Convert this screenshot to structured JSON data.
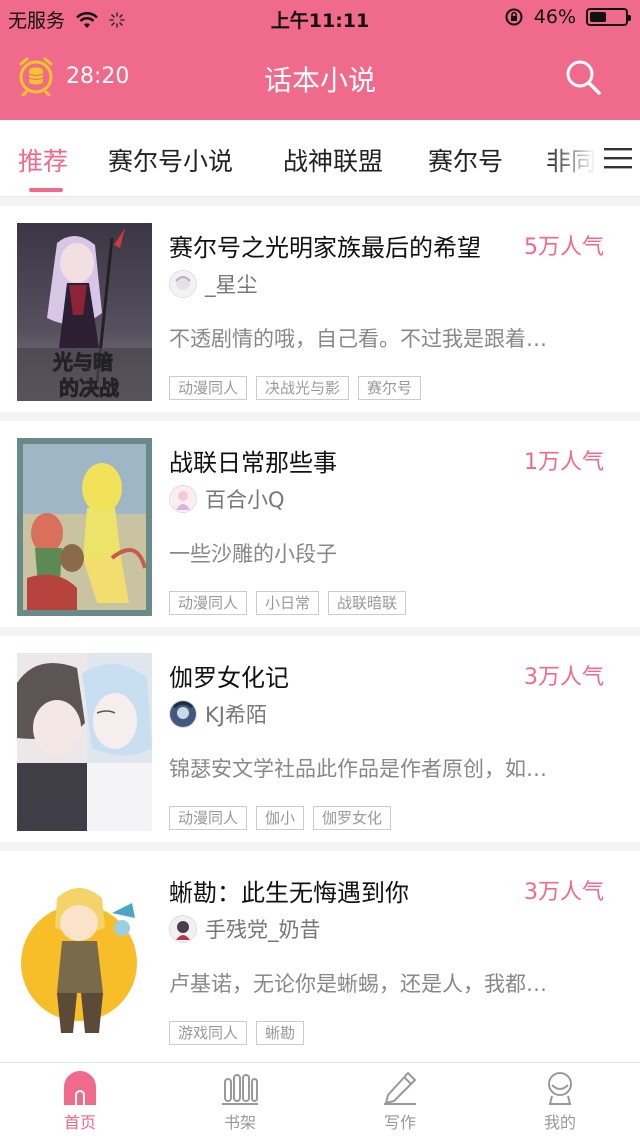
{
  "status_bar": {
    "carrier": "无服务",
    "time": "上午11:11",
    "battery_text": "46%",
    "battery_level": 0.46
  },
  "header": {
    "timer_text": "28:20",
    "title": "话本小说",
    "timer_icon": "alarm-clock-coin-icon",
    "search_icon": "search-icon"
  },
  "tabs": [
    {
      "label": "推荐",
      "active": true
    },
    {
      "label": "赛尔号小说"
    },
    {
      "label": "战神联盟"
    },
    {
      "label": "赛尔号"
    },
    {
      "label": "非同"
    }
  ],
  "menu_icon": "menu-icon",
  "books": [
    {
      "title": "赛尔号之光明家族最后的希望",
      "popularity": "5万人气",
      "author": "_星尘",
      "description": "不透剧情的哦，自己看。不过我是跟着…",
      "tags": [
        "动漫同人",
        "决战光与影",
        "赛尔号"
      ],
      "cover_text": "光与暗的决战"
    },
    {
      "title": "战联日常那些事",
      "popularity": "1万人气",
      "author": "百合小Q",
      "description": "一些沙雕的小段子",
      "tags": [
        "动漫同人",
        "小日常",
        "战联暗联"
      ]
    },
    {
      "title": "伽罗女化记",
      "popularity": "3万人气",
      "author": "KJ希陌",
      "description": "锦瑟安文学社品此作品是作者原创，如…",
      "tags": [
        "动漫同人",
        "伽小",
        "伽罗女化"
      ]
    },
    {
      "title": "蜥勘：此生无悔遇到你",
      "popularity": "3万人气",
      "author": "手残党_奶昔",
      "description": "卢基诺，无论你是蜥蜴，还是人，我都…",
      "tags": [
        "游戏同人",
        "蜥勘"
      ]
    }
  ],
  "bottom_nav": [
    {
      "label": "首页",
      "icon": "home-icon",
      "active": true
    },
    {
      "label": "书架",
      "icon": "bookshelf-icon"
    },
    {
      "label": "写作",
      "icon": "pen-icon"
    },
    {
      "label": "我的",
      "icon": "profile-icon"
    }
  ],
  "colors": {
    "accent": "#f06a8b",
    "text": "#111111",
    "muted": "#888888"
  }
}
